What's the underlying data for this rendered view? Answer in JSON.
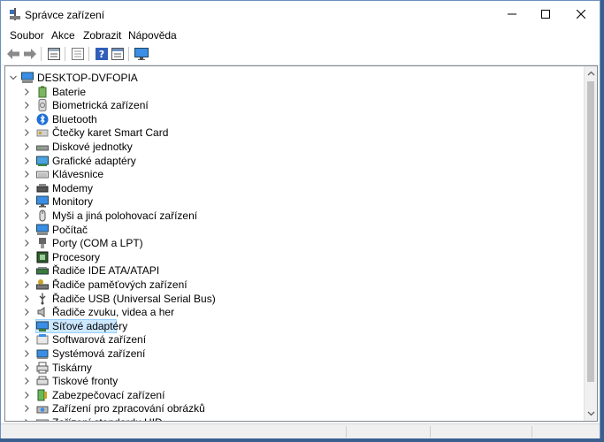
{
  "window": {
    "title": "Správce zařízení"
  },
  "menu": [
    "Soubor",
    "Akce",
    "Zobrazit",
    "Nápověda"
  ],
  "toolbar": [
    {
      "name": "back-icon"
    },
    {
      "name": "forward-icon"
    },
    {
      "name": "properties-icon"
    },
    {
      "name": "list-view-icon"
    },
    {
      "name": "help-icon"
    },
    {
      "name": "details-view-icon"
    },
    {
      "name": "monitor-icon"
    }
  ],
  "tree": {
    "root": "DESKTOP-DVFOPIA",
    "items": [
      {
        "label": "Baterie",
        "icon": "battery-icon"
      },
      {
        "label": "Biometrická zařízení",
        "icon": "fingerprint-icon"
      },
      {
        "label": "Bluetooth",
        "icon": "bluetooth-icon"
      },
      {
        "label": "Čtečky karet Smart Card",
        "icon": "smart-card-icon"
      },
      {
        "label": "Diskové jednotky",
        "icon": "disk-drive-icon"
      },
      {
        "label": "Grafické adaptéry",
        "icon": "display-adapter-icon"
      },
      {
        "label": "Klávesnice",
        "icon": "keyboard-icon"
      },
      {
        "label": "Modemy",
        "icon": "modem-icon"
      },
      {
        "label": "Monitory",
        "icon": "monitor-icon"
      },
      {
        "label": "Myši a jiná polohovací zařízení",
        "icon": "mouse-icon"
      },
      {
        "label": "Počítač",
        "icon": "computer-icon"
      },
      {
        "label": "Porty (COM a LPT)",
        "icon": "port-icon"
      },
      {
        "label": "Procesory",
        "icon": "processor-icon"
      },
      {
        "label": "Řadiče IDE ATA/ATAPI",
        "icon": "ide-controller-icon"
      },
      {
        "label": "Řadiče paměťových zařízení",
        "icon": "storage-controller-icon"
      },
      {
        "label": "Řadiče USB (Universal Serial Bus)",
        "icon": "usb-icon"
      },
      {
        "label": "Řadiče zvuku, videa a her",
        "icon": "speaker-icon"
      },
      {
        "label": "Síťové adaptéry",
        "icon": "network-adapter-icon",
        "selected": true
      },
      {
        "label": "Softwarová zařízení",
        "icon": "software-device-icon"
      },
      {
        "label": "Systémová zařízení",
        "icon": "system-device-icon"
      },
      {
        "label": "Tiskárny",
        "icon": "printer-icon"
      },
      {
        "label": "Tiskové fronty",
        "icon": "print-queue-icon"
      },
      {
        "label": "Zabezpečovací zařízení",
        "icon": "security-device-icon"
      },
      {
        "label": "Zařízení pro zpracování obrázků",
        "icon": "imaging-device-icon"
      },
      {
        "label": "Zařízení standardu HID",
        "icon": "hid-icon"
      }
    ]
  },
  "colors": {
    "selection": "#cce8ff",
    "selection_border": "#99d1ff",
    "icon_blue": "#2f7ed8"
  }
}
